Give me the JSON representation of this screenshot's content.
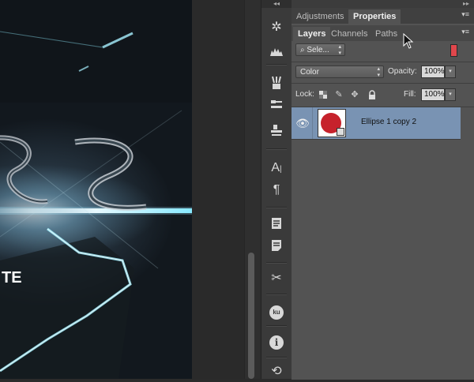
{
  "canvas": {
    "partial_text_large": "SS",
    "partial_text_small": "TE"
  },
  "tool_strip": {
    "icons": [
      "compass-icon",
      "histogram-icon",
      "brushes-icon",
      "tool-presets-icon",
      "clone-source-icon",
      "character-icon",
      "paragraph-icon",
      "notes-icon",
      "info-panel-icon",
      "tools-icon",
      "kuler-icon",
      "info-icon",
      "history-icon"
    ]
  },
  "panel_group_top": {
    "tabs": [
      {
        "label": "Adjustments"
      },
      {
        "label": "Properties"
      }
    ],
    "active_tab": "Properties"
  },
  "panel_group_layers": {
    "tabs": [
      {
        "label": "Layers"
      },
      {
        "label": "Channels"
      },
      {
        "label": "Paths"
      }
    ],
    "active_tab": "Layers"
  },
  "layers": {
    "filter_select": "Sele...",
    "filter_toggle_color": "#e0474c",
    "blend_mode": "Color",
    "opacity_label": "Opacity:",
    "opacity_value": "100%",
    "lock_label": "Lock:",
    "fill_label": "Fill:",
    "fill_value": "100%",
    "items": [
      {
        "name": "Ellipse 1 copy 2",
        "visible": true,
        "selected": true,
        "thumbnail_color": "#c6222c"
      }
    ]
  },
  "colors": {
    "panel_bg": "#535353",
    "selected_row": "#7993b3",
    "accent_glow": "#7fe9ff"
  }
}
